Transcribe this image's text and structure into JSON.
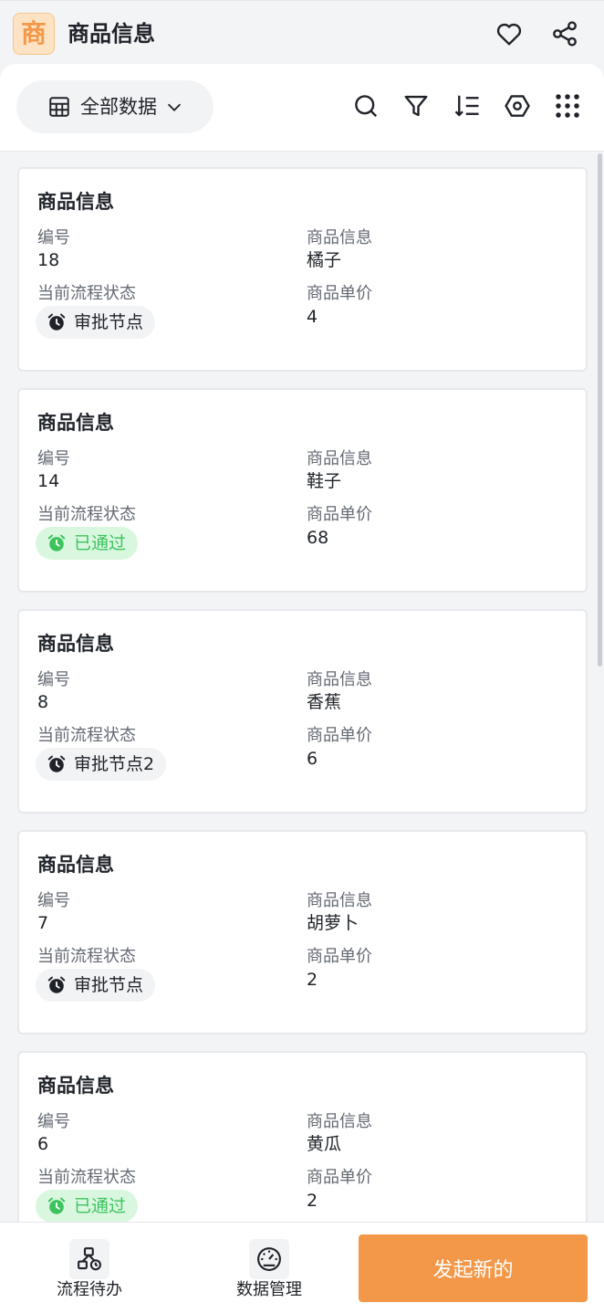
{
  "header": {
    "logo_text": "商",
    "title": "商品信息",
    "icons": [
      "heart-icon",
      "share-icon"
    ]
  },
  "toolbar": {
    "view_label": "全部数据",
    "icons": [
      "table-icon",
      "chevron-down-icon",
      "search-icon",
      "filter-icon",
      "sort-icon",
      "settings-icon",
      "grid-menu-icon"
    ]
  },
  "labels": {
    "card_title": "商品信息",
    "id": "编号",
    "name": "商品信息",
    "status": "当前流程状态",
    "price": "商品单价"
  },
  "records": [
    {
      "id": "18",
      "name": "橘子",
      "status": "审批节点",
      "status_type": "pending",
      "price": "4"
    },
    {
      "id": "14",
      "name": "鞋子",
      "status": "已通过",
      "status_type": "passed",
      "price": "68"
    },
    {
      "id": "8",
      "name": "香蕉",
      "status": "审批节点2",
      "status_type": "pending",
      "price": "6"
    },
    {
      "id": "7",
      "name": "胡萝卜",
      "status": "审批节点",
      "status_type": "pending",
      "price": "2"
    },
    {
      "id": "6",
      "name": "黄瓜",
      "status": "已通过",
      "status_type": "passed",
      "price": "2"
    }
  ],
  "bottom_nav": {
    "todo_label": "流程待办",
    "data_label": "数据管理",
    "new_label": "发起新的"
  },
  "colors": {
    "accent": "#f39848",
    "passed_bg": "#d9f7df",
    "passed_text": "#3cc35e",
    "pending_bg": "#f2f3f5"
  }
}
